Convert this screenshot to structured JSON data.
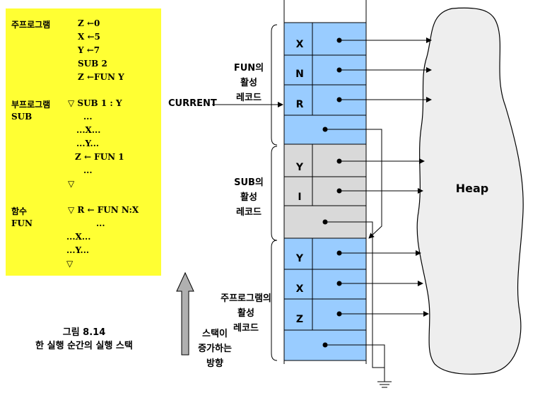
{
  "code": {
    "main_label": "주프로그램",
    "main_lines": [
      "Z ←0",
      "X ←5",
      "Y ←7",
      "SUB 2",
      "Z ←FUN Y"
    ],
    "sub_label1": "부프로그램",
    "sub_label2": "SUB",
    "sub_lines": [
      "▽ SUB 1 : Y",
      "...",
      "...X...",
      "...Y...",
      "Z ← FUN 1",
      "...",
      "▽"
    ],
    "fun_label1": "함수",
    "fun_label2": "FUN",
    "fun_lines": [
      "▽ R ← FUN N:X",
      "...",
      "...X...",
      "...Y...",
      "▽"
    ]
  },
  "caption": {
    "line1": "그림 8.14",
    "line2": "한 실행 순간의 실행 스택"
  },
  "arrow_label": {
    "line1": "스택이",
    "line2": "증가하는",
    "line3": "방향"
  },
  "current_label": "CURRENT",
  "records": {
    "fun": {
      "line1": "FUN의",
      "line2": "활성",
      "line3": "레코드",
      "cells": [
        "X",
        "N",
        "R"
      ]
    },
    "sub": {
      "line1": "SUB의",
      "line2": "활성",
      "line3": "레코드",
      "cells": [
        "Y",
        "I"
      ]
    },
    "main": {
      "line1": "주프로그램의",
      "line2": "활성",
      "line3": "레코드",
      "cells": [
        "Y",
        "X",
        "Z"
      ]
    }
  },
  "heap_label": "Heap",
  "colors": {
    "code_bg": "#ffff33",
    "fun_record": "#99ccff",
    "sub_record": "#d9d9d9",
    "main_record": "#99ccff",
    "heap": "#eeeeee"
  }
}
